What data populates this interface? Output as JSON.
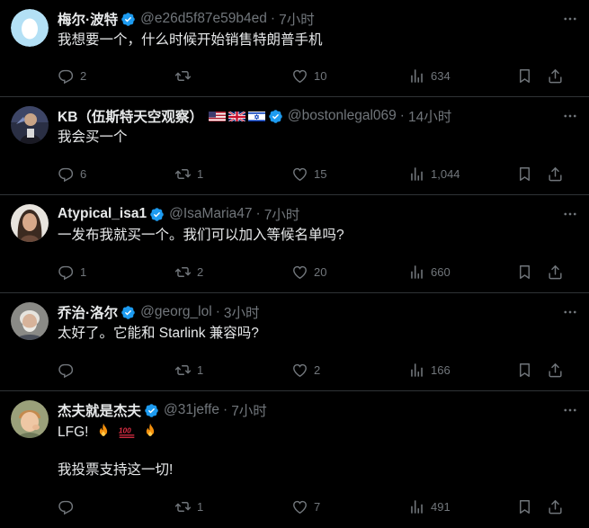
{
  "tweets": [
    {
      "name": "梅尔·波特",
      "handle": "@e26d5f87e59b4ed",
      "dot": "·",
      "time": "7小时",
      "text": "我想要一个，什么时候开始销售特朗普手机",
      "replies": "2",
      "retweets": "",
      "likes": "10",
      "views": "634",
      "avatar": "egg-avatar"
    },
    {
      "name": "KB（伍斯特天空观察）",
      "flags": [
        "us-flag",
        "uk-flag",
        "israel-flag"
      ],
      "handle": "@bostonlegal069",
      "dot": "·",
      "time": "14小时",
      "text": "我会买一个",
      "replies": "6",
      "retweets": "1",
      "likes": "15",
      "views": "1,044",
      "avatar": "person-avatar"
    },
    {
      "name": "Atypical_isa1",
      "handle": "@IsaMaria47",
      "dot": "·",
      "time": "7小时",
      "text": "一发布我就买一个。我们可以加入等候名单吗?",
      "replies": "1",
      "retweets": "2",
      "likes": "20",
      "views": "660",
      "avatar": "woman-avatar"
    },
    {
      "name": "乔治·洛尔",
      "handle": "@georg_lol",
      "dot": "·",
      "time": "3小时",
      "text": "太好了。它能和 Starlink 兼容吗?",
      "replies": "",
      "retweets": "1",
      "likes": "2",
      "views": "166",
      "avatar": "old-man-avatar"
    },
    {
      "name": "杰夫就是杰夫",
      "handle": "@31jeffe",
      "dot": "·",
      "time": "7小时",
      "text": "LFG!",
      "emojis": [
        "fire-emoji",
        "hundred-points-emoji",
        "fire-emoji"
      ],
      "text2": "我投票支持这一切!",
      "replies": "",
      "retweets": "1",
      "likes": "7",
      "views": "491",
      "avatar": "boy-avatar"
    }
  ],
  "colors": {
    "background": "#000000",
    "text": "#e7e9ea",
    "muted": "#71767b",
    "divider": "#2f3336",
    "verified": "#1d9bf0"
  }
}
